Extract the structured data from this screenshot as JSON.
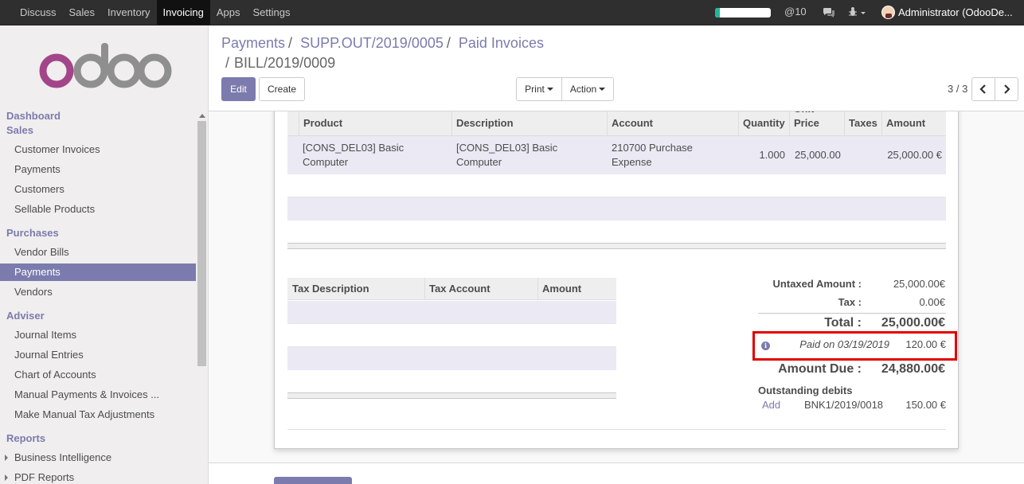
{
  "topbar": {
    "menu": [
      "Discuss",
      "Sales",
      "Inventory",
      "Invoicing",
      "Apps",
      "Settings"
    ],
    "active_menu": "Invoicing",
    "progress_fraction": 0.08,
    "mentions_label": "@10",
    "user_label": "Administrator (OdooDe..."
  },
  "sidebar": {
    "dashboard": "Dashboard",
    "sales_section": "Sales",
    "sales_items": [
      "Customer Invoices",
      "Payments",
      "Customers",
      "Sellable Products"
    ],
    "purchases_section": "Purchases",
    "purchases_items": [
      "Vendor Bills",
      "Payments",
      "Vendors"
    ],
    "adviser_section": "Adviser",
    "adviser_items": [
      "Journal Items",
      "Journal Entries",
      "Chart of Accounts",
      "Manual Payments & Invoices ...",
      "Make Manual Tax Adjustments"
    ],
    "reports_section": "Reports",
    "reports_items": [
      "Business Intelligence",
      "PDF Reports"
    ],
    "active_item": "Payments"
  },
  "breadcrumb": {
    "item1": "Payments",
    "item2": "SUPP.OUT/2019/0005",
    "item3": "Paid Invoices",
    "current": "BILL/2019/0009",
    "sep": "/"
  },
  "buttons": {
    "edit": "Edit",
    "create": "Create",
    "print": "Print",
    "action": "Action"
  },
  "pager": {
    "value": "3 / 3"
  },
  "invoice_lines": {
    "headers": [
      "Product",
      "Description",
      "Account",
      "Quantity",
      "Unit Price",
      "Taxes",
      "Amount"
    ],
    "rows": [
      {
        "product": "[CONS_DEL03] Basic Computer",
        "description": "[CONS_DEL03] Basic Computer",
        "account": "210700 Purchase Expense",
        "quantity": "1.000",
        "unit_price": "25,000.00",
        "taxes": "",
        "amount": "25,000.00 €"
      }
    ]
  },
  "tax_table": {
    "headers": [
      "Tax Description",
      "Tax Account",
      "Amount"
    ]
  },
  "totals": {
    "untaxed_label": "Untaxed Amount :",
    "untaxed_value": "25,000.00€",
    "tax_label": "Tax :",
    "tax_value": "0.00€",
    "total_label": "Total :",
    "total_value": "25,000.00€",
    "paid_label": "Paid on 03/19/2019",
    "paid_value": "120.00 €",
    "amount_due_label": "Amount Due :",
    "amount_due_value": "24,880.00€",
    "outstanding_label": "Outstanding debits",
    "outstanding_add": "Add",
    "outstanding_ref": "BNK1/2019/0018",
    "outstanding_value": "150.00 €"
  },
  "colors": {
    "accent": "#7c7bad",
    "highlight_box": "#e00000",
    "navbar": "#2f2f2f"
  }
}
